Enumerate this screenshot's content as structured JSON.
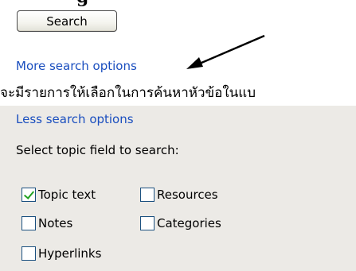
{
  "search": {
    "button_label": "Search",
    "more_options_label": "More search options"
  },
  "caption": "จะมีรายการให้เลือกในการค้นหาหัวข้อในแบ",
  "panel": {
    "less_options_label": "Less search options",
    "field_title": "Select topic field to search:",
    "options": [
      {
        "label": "Topic text",
        "checked": true
      },
      {
        "label": "Resources",
        "checked": false
      },
      {
        "label": "Notes",
        "checked": false
      },
      {
        "label": "Categories",
        "checked": false
      },
      {
        "label": "Hyperlinks",
        "checked": false
      }
    ]
  },
  "colors": {
    "link": "#1b4fbf",
    "panel_bg": "#eceae6",
    "check": "#21a121",
    "checkbox_border": "#1c5180"
  }
}
